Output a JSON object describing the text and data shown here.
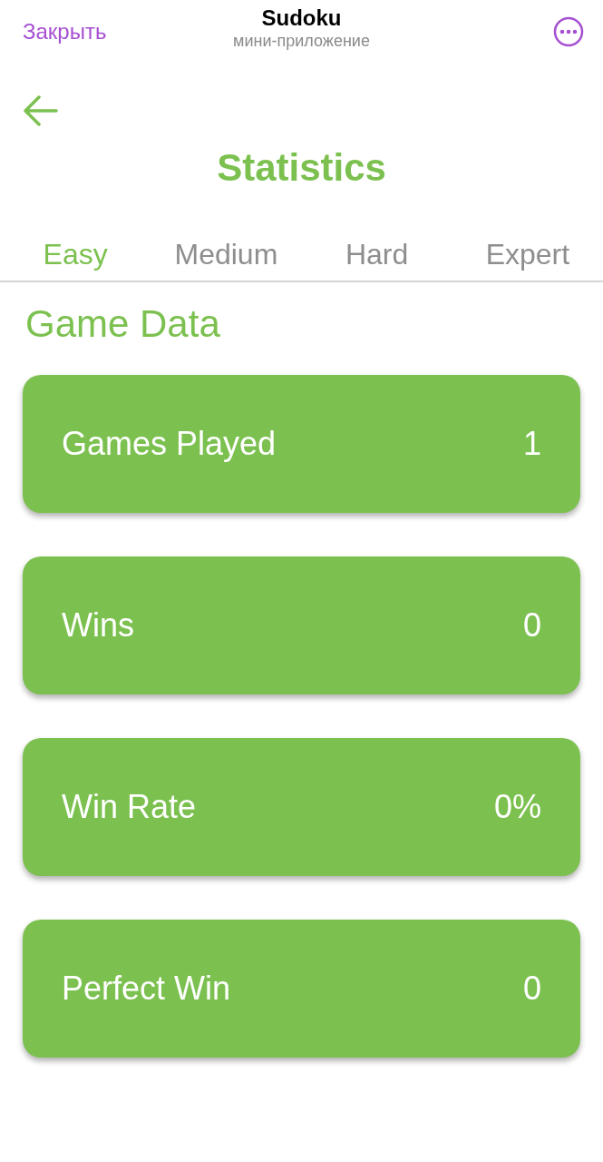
{
  "top_bar": {
    "close": "Закрыть",
    "title": "Sudoku",
    "subtitle": "мини-приложение"
  },
  "page": {
    "title": "Statistics"
  },
  "tabs": [
    {
      "label": "Easy",
      "selected": true
    },
    {
      "label": "Medium",
      "selected": false
    },
    {
      "label": "Hard",
      "selected": false
    },
    {
      "label": "Expert",
      "selected": false
    }
  ],
  "section": {
    "title": "Game Data"
  },
  "stats": [
    {
      "label": "Games Played",
      "value": "1"
    },
    {
      "label": "Wins",
      "value": "0"
    },
    {
      "label": "Win Rate",
      "value": "0%"
    },
    {
      "label": "Perfect Win",
      "value": "0"
    }
  ]
}
